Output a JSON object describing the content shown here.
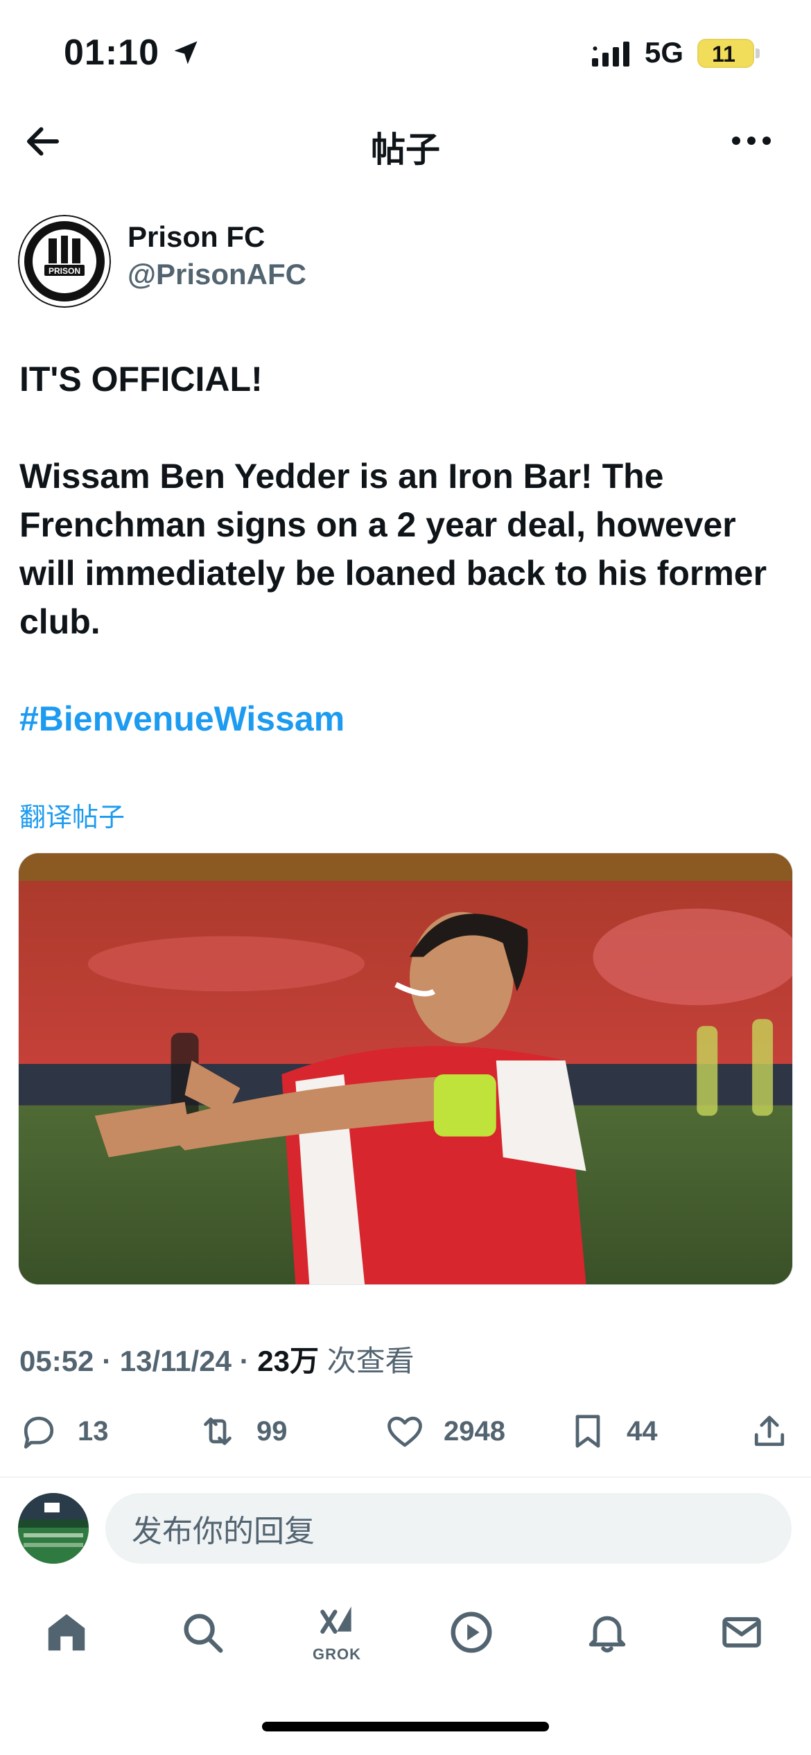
{
  "status_bar": {
    "time": "01:10",
    "network": "5G",
    "battery": "11",
    "icons": [
      "location-arrow-icon",
      "signal-icon",
      "battery-charging-icon"
    ]
  },
  "nav": {
    "title": "帖子",
    "icons": [
      "back-arrow-icon",
      "more-icon"
    ]
  },
  "author": {
    "name": "Prison FC",
    "handle": "@PrisonAFC",
    "avatar_text": "PRISON"
  },
  "tweet": {
    "headline": "IT'S OFFICIAL!",
    "body": "Wissam Ben Yedder is an Iron Bar! The Frenchman signs on a 2 year deal, however will immediately be loaned back to his former club.",
    "hashtag": "#BienvenueWissam",
    "translate_label": "翻译帖子",
    "image_alt": "Wissam Ben Yedder in a red and white kit celebrating on the pitch"
  },
  "meta": {
    "time": "05:52",
    "date": "13/11/24",
    "views_count": "23万",
    "views_label": "次查看",
    "separator": "·"
  },
  "actions": {
    "replies": "13",
    "reposts": "99",
    "likes": "2948",
    "bookmarks": "44"
  },
  "reply": {
    "placeholder": "发布你的回复"
  },
  "tab_bar": {
    "grok_label": "GROK",
    "icons": [
      "home-icon",
      "search-icon",
      "grok-icon",
      "video-play-icon",
      "notifications-bell-icon",
      "mail-icon"
    ]
  },
  "colors": {
    "accent": "#1d9bf0",
    "secondary_text": "#536471",
    "battery": "#f2dd5a"
  }
}
